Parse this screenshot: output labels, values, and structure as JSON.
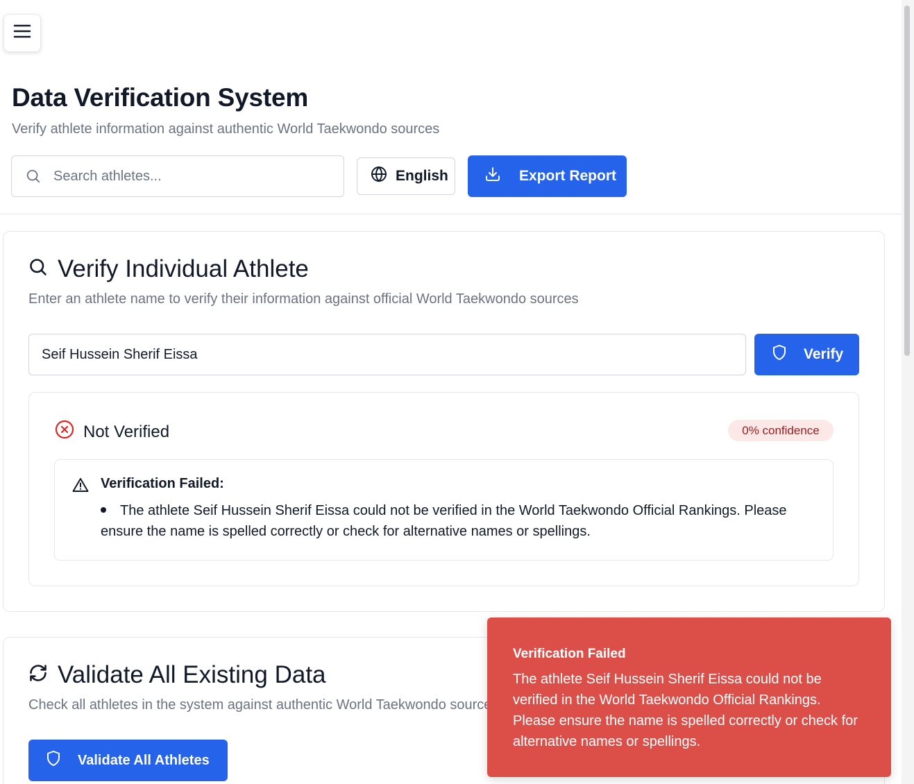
{
  "header": {
    "title": "Data Verification System",
    "subtitle": "Verify athlete information against authentic World Taekwondo sources",
    "search_placeholder": "Search athletes...",
    "language_label": "English",
    "export_label": "Export Report"
  },
  "verify_card": {
    "title": "Verify Individual Athlete",
    "description": "Enter an athlete name to verify their information against official World Taekwondo sources",
    "input_value": "Seif Hussein Sherif Eissa",
    "verify_label": "Verify",
    "result": {
      "status": "Not Verified",
      "confidence": "0% confidence",
      "alert_title": "Verification Failed:",
      "alert_items": [
        "The athlete Seif Hussein Sherif Eissa could not be verified in the World Taekwondo Official Rankings. Please ensure the name is spelled correctly or check for alternative names or spellings."
      ]
    }
  },
  "validate_card": {
    "title": "Validate All Existing Data",
    "description": "Check all athletes in the system against authentic World Taekwondo sources",
    "button_label": "Validate All Athletes"
  },
  "toast": {
    "title": "Verification Failed",
    "message": "The athlete Seif Hussein Sherif Eissa could not be verified in the World Taekwondo Official Rankings. Please ensure the name is spelled correctly or check for alternative names or spellings."
  },
  "colors": {
    "primary": "#2563eb",
    "toast_bg": "#dc4f48",
    "error": "#dc2626",
    "badge_bg": "#fde8e8",
    "badge_text": "#991b1b",
    "muted_text": "#6b7280"
  },
  "icons": {
    "menu": "menu-icon",
    "search": "search-icon",
    "globe": "globe-icon",
    "download": "download-icon",
    "shield": "shield-icon",
    "x_circle": "x-circle-icon",
    "warning": "warning-triangle-icon",
    "refresh": "refresh-icon"
  }
}
